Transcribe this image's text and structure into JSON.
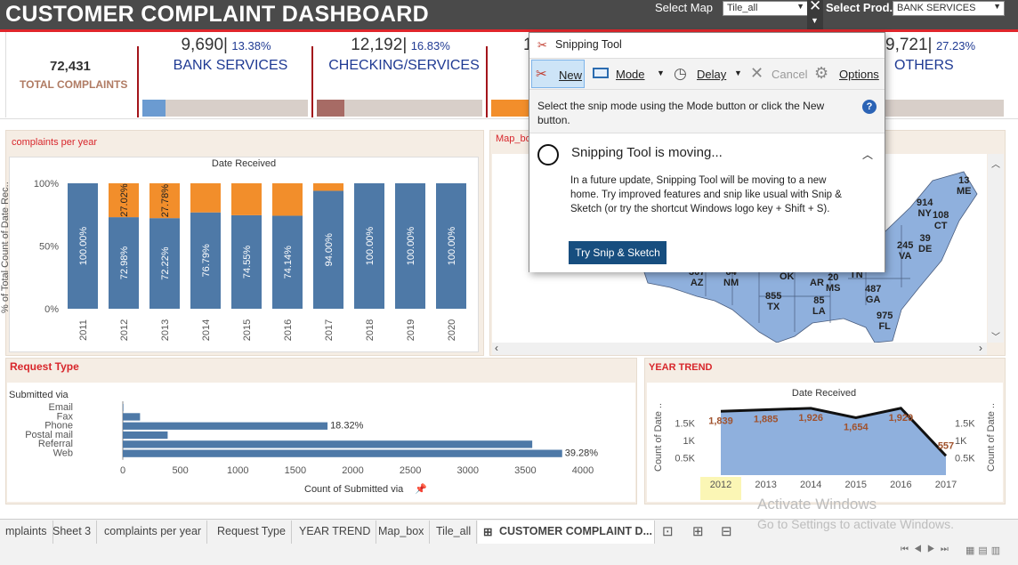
{
  "title": "CUSTOMER COMPLAINT DASHBOARD",
  "filters": {
    "map_label": "Select Map",
    "map_value": "Tile_all",
    "product_label": "Select Prod..",
    "product_value": "BANK SERVICES"
  },
  "kpis": {
    "total_num": "72,431",
    "total_label": "TOTAL COMPLAINTS",
    "items": [
      {
        "num": "9,690",
        "pct": "13.38%",
        "name": "BANK SERVICES",
        "color": "#6b9bd1"
      },
      {
        "num": "12,192",
        "pct": "16.83%",
        "name": "CHECKING/SERVICES",
        "color": "#a76b65"
      },
      {
        "num": "1",
        "pct": "",
        "name": "",
        "color": "#f28e2b"
      },
      {
        "num": "9,721",
        "pct": "27.23%",
        "name": "OTHERS",
        "color": "#d8cfc9"
      }
    ]
  },
  "per_year": {
    "panel_title": "complaints per year",
    "chart_data": {
      "type": "bar",
      "stacked": true,
      "title": "Date Received",
      "ylabel": "% of Total Count of Date Rec..",
      "ylim": [
        0,
        100
      ],
      "yticks": [
        "100%",
        "50%",
        "0%"
      ],
      "categories": [
        "2011",
        "2012",
        "2013",
        "2014",
        "2015",
        "2016",
        "2017",
        "2018",
        "2019",
        "2020"
      ],
      "series": [
        {
          "color": "#4e79a7",
          "values": [
            100,
            72.98,
            72.22,
            76.79,
            74.55,
            74.14,
            94.0,
            100,
            100,
            100
          ],
          "labels": [
            "100.00%",
            "72.98%",
            "72.22%",
            "76.79%",
            "74.55%",
            "74.14%",
            "94.00%",
            "100.00%",
            "100.00%",
            "100.00%"
          ]
        },
        {
          "color": "#f28e2b",
          "values": [
            0,
            27.02,
            27.78,
            23.21,
            25.45,
            25.86,
            6.0,
            0,
            0,
            0
          ],
          "labels": [
            "",
            "27.02%",
            "27.78%",
            "",
            "",
            "",
            "",
            "",
            "",
            ""
          ]
        }
      ]
    }
  },
  "map": {
    "panel_title": "Map_bo",
    "states": [
      {
        "label": "13",
        "sub": "ME"
      },
      {
        "label": "914",
        "sub": "NY"
      },
      {
        "label": "108",
        "sub": "CT"
      },
      {
        "label": "39",
        "sub": "DE"
      },
      {
        "label": "245",
        "sub": "VA"
      },
      {
        "label": "OK",
        "sub": ""
      },
      {
        "label": "20",
        "sub": "MS"
      },
      {
        "label": "AR",
        "sub": ""
      },
      {
        "label": "TN",
        "sub": ""
      },
      {
        "label": "487",
        "sub": "GA"
      },
      {
        "label": "855",
        "sub": "TX"
      },
      {
        "label": "85",
        "sub": "LA"
      },
      {
        "label": "975",
        "sub": "FL"
      },
      {
        "label": "307",
        "sub": "AZ"
      },
      {
        "label": "64",
        "sub": "NM"
      }
    ]
  },
  "request_type": {
    "panel_title": "Request Type",
    "chart_data": {
      "type": "bar",
      "orientation": "horizontal",
      "ylabel": "Submitted via",
      "xlabel": "Count of Submitted via",
      "categories": [
        "Email",
        "Fax",
        "Phone",
        "Postal mail",
        "Referral",
        "Web"
      ],
      "values": [
        5,
        150,
        1780,
        390,
        3560,
        3820
      ],
      "labels": [
        "",
        "",
        "18.32%",
        "",
        "",
        "39.28%"
      ],
      "xlim": [
        0,
        4000
      ],
      "xticks": [
        "0",
        "500",
        "1000",
        "1500",
        "2000",
        "2500",
        "3000",
        "3500",
        "4000"
      ],
      "color": "#4e79a7"
    }
  },
  "year_trend": {
    "panel_title": "YEAR TREND",
    "chart_data": {
      "type": "area",
      "title": "Date Received",
      "ylabel": "Count of Date ..",
      "x": [
        "2012",
        "2013",
        "2014",
        "2015",
        "2016",
        "2017"
      ],
      "values": [
        1839,
        1885,
        1926,
        1654,
        1929,
        557
      ],
      "labels": [
        "1,839",
        "1,885",
        "1,926",
        "1,654",
        "1,929",
        "557"
      ],
      "ylim": [
        0,
        2000
      ],
      "yticks": [
        "1.5K",
        "1K",
        "0.5K"
      ],
      "highlight_x": "2012"
    }
  },
  "tabs": [
    "mplaints",
    "Sheet 3",
    "complaints per year",
    "Request Type",
    "YEAR TREND",
    "Map_box",
    "Tile_all",
    "CUSTOMER COMPLAINT D..."
  ],
  "watermark": {
    "line1": "Activate Windows",
    "line2": "Go to Settings to activate Windows."
  },
  "snip": {
    "title": "Snipping Tool",
    "new_label": "New",
    "mode_label": "Mode",
    "delay_label": "Delay",
    "cancel_label": "Cancel",
    "options_label": "Options",
    "hint": "Select the snip mode using the Mode button or click the New button.",
    "moving_title": "Snipping Tool is moving...",
    "moving_body": "In a future update, Snipping Tool will be moving to a new home. Try improved features and snip like usual with Snip & Sketch (or try the shortcut Windows logo key + Shift + S).",
    "try_button": "Try Snip & Sketch"
  }
}
